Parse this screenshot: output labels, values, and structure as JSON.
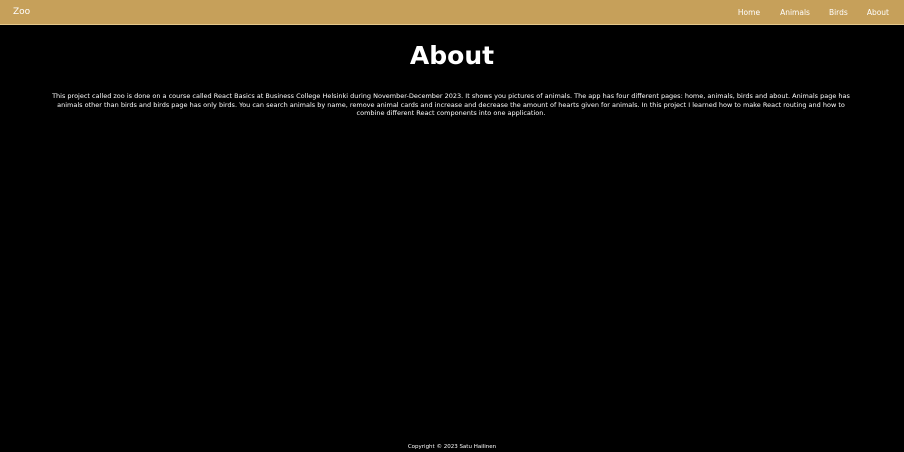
{
  "navbar": {
    "brand": "Zoo",
    "links": [
      {
        "label": "Home"
      },
      {
        "label": "Animals"
      },
      {
        "label": "Birds"
      },
      {
        "label": "About"
      }
    ]
  },
  "main": {
    "title": "About",
    "description": "This project called zoo is done on a course called React Basics at Business College Helsinki during November-December 2023. It shows you pictures of animals. The app has four different pages: home, animals, birds and about. Animals page has animals other than birds and birds page has only birds. You can search animals by name, remove animal cards and increase and decrease the amount of hearts given for animals. In this project I learned how to make React routing and how to combine different React components into one application."
  },
  "footer": {
    "copyright": "Copyright © 2023 Satu Hailinen"
  },
  "colors": {
    "navbar_background": "#c6a05a",
    "page_background": "#000000",
    "text": "#ffffff"
  }
}
